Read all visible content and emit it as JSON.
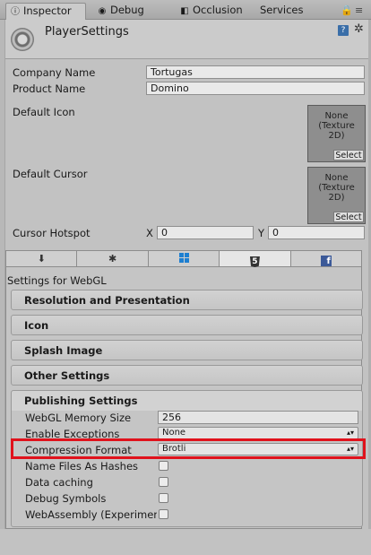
{
  "tabs": [
    {
      "label": "Inspector",
      "icon": "info-icon",
      "active": true
    },
    {
      "label": "Debug",
      "icon": "debug-icon",
      "active": false
    },
    {
      "label": "Occlusion",
      "icon": "occlusion-icon",
      "active": false
    },
    {
      "label": "Services",
      "icon": "",
      "active": false
    }
  ],
  "window_controls": {
    "lock": "🔒",
    "menu": "≡"
  },
  "header": {
    "title": "PlayerSettings",
    "help": "?",
    "settings_glyph": "✲"
  },
  "player": {
    "company_label": "Company Name",
    "company_value": "Tortugas",
    "product_label": "Product Name",
    "product_value": "Domino",
    "default_icon_label": "Default Icon",
    "default_cursor_label": "Default Cursor",
    "slot_text": "None\n(Texture\n2D)",
    "select_label": "Select",
    "hotspot_label": "Cursor Hotspot",
    "x_label": "X",
    "x_value": "0",
    "y_label": "Y",
    "y_value": "0"
  },
  "platform_tabs": [
    "standalone",
    "android",
    "windows",
    "webgl",
    "facebook"
  ],
  "settings_for": "Settings for WebGL",
  "sections": {
    "resolution": "Resolution and Presentation",
    "icon": "Icon",
    "splash": "Splash Image",
    "other": "Other Settings",
    "publishing": "Publishing Settings"
  },
  "publishing": {
    "memory_label": "WebGL Memory Size",
    "memory_value": "256",
    "exceptions_label": "Enable Exceptions",
    "exceptions_value": "None",
    "compression_label": "Compression Format",
    "compression_value": "Brotli",
    "name_files_label": "Name Files As Hashes",
    "data_caching_label": "Data caching",
    "debug_symbols_label": "Debug Symbols",
    "webassembly_label": "WebAssembly (Experimer"
  },
  "colors": {
    "highlight": "#e0121c",
    "panel": "#c2c2c2",
    "facebook": "#3b5998",
    "windows": "#1d7fd1"
  }
}
